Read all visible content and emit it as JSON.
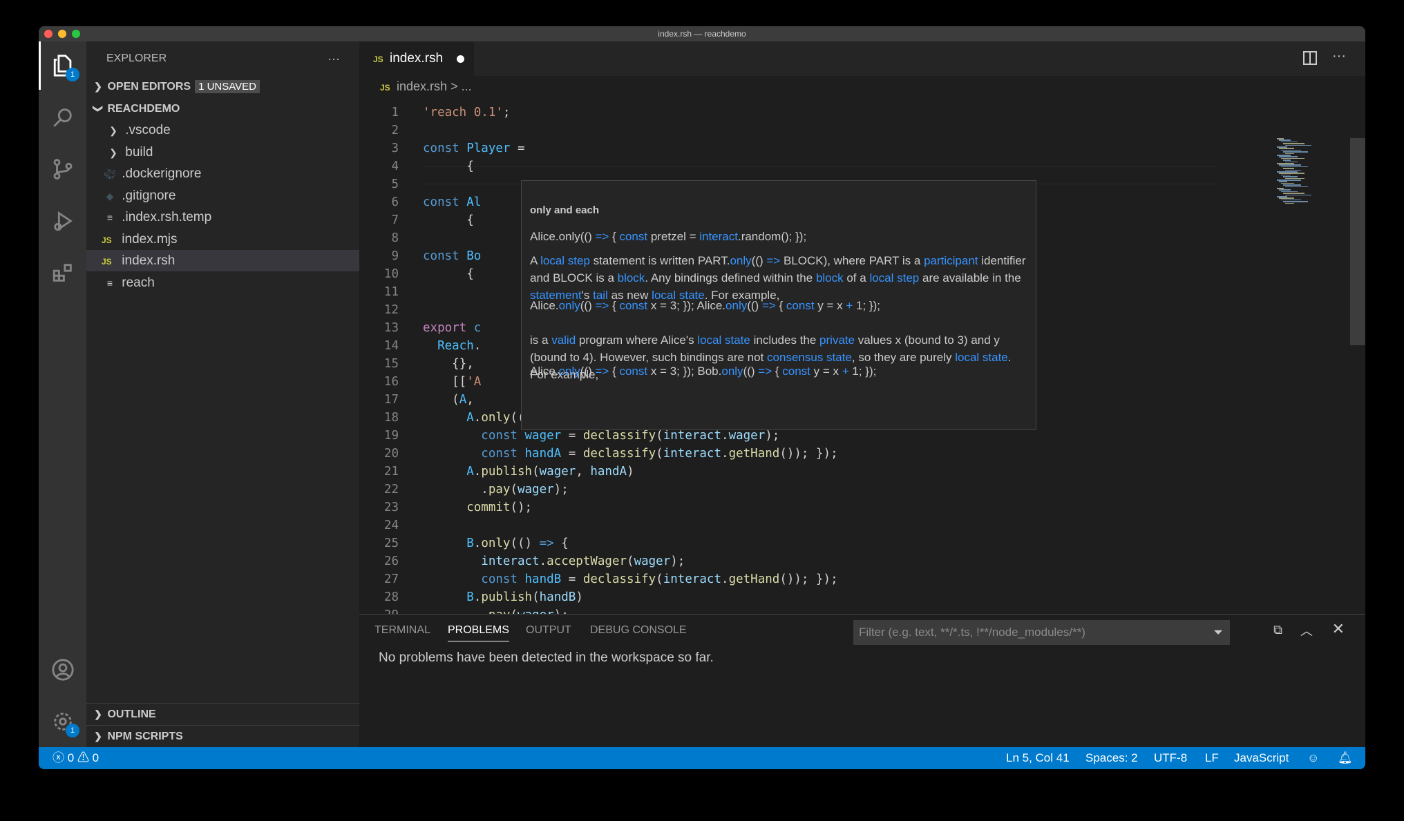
{
  "window": {
    "title": "index.rsh — reachdemo"
  },
  "activity": {
    "explorer_badge": "1",
    "settings_badge": "1"
  },
  "sidebar": {
    "title": "EXPLORER",
    "more": "···",
    "open_editors": "OPEN EDITORS",
    "unsaved_badge": "1 UNSAVED",
    "folder": "REACHDEMO",
    "items": [
      {
        "label": ".vscode",
        "kind": "folder"
      },
      {
        "label": "build",
        "kind": "folder"
      },
      {
        "label": ".dockerignore",
        "kind": "docker"
      },
      {
        "label": ".gitignore",
        "kind": "git"
      },
      {
        "label": ".index.rsh.temp",
        "kind": "text"
      },
      {
        "label": "index.mjs",
        "kind": "js"
      },
      {
        "label": "index.rsh",
        "kind": "js",
        "selected": true
      },
      {
        "label": "reach",
        "kind": "text"
      }
    ],
    "outline": "OUTLINE",
    "npm_scripts": "NPM SCRIPTS"
  },
  "editor": {
    "tab": {
      "icon": "JS",
      "label": "index.rsh",
      "dirty": true
    },
    "breadcrumb": {
      "icon": "JS",
      "file": "index.rsh",
      "sep": ">",
      "rest": "..."
    },
    "lines": [
      [
        [
          "s",
          "'reach 0.1'"
        ],
        [
          "p",
          ";"
        ]
      ],
      [],
      [
        [
          "k",
          "const "
        ],
        [
          "c",
          "Player"
        ],
        [
          "p",
          " ="
        ]
      ],
      [
        [
          "p",
          "      {"
        ]
      ],
      [],
      [
        [
          "k",
          "const "
        ],
        [
          "c",
          "Al"
        ]
      ],
      [
        [
          "p",
          "      {"
        ]
      ],
      [],
      [
        [
          "k",
          "const "
        ],
        [
          "c",
          "Bo"
        ]
      ],
      [
        [
          "p",
          "      {"
        ]
      ],
      [],
      [],
      [
        [
          "x",
          "export "
        ],
        [
          "k",
          "c"
        ]
      ],
      [
        [
          "c",
          "  Reach"
        ],
        [
          "p",
          "."
        ]
      ],
      [
        [
          "p",
          "    {},"
        ]
      ],
      [
        [
          "p",
          "    [["
        ],
        [
          "s",
          "'A"
        ]
      ],
      [
        [
          "p",
          "    ("
        ],
        [
          "c",
          "A"
        ],
        [
          "p",
          ","
        ]
      ],
      [
        [
          "c",
          "      A"
        ],
        [
          "p",
          "."
        ],
        [
          "f",
          "only"
        ],
        [
          "p",
          "(() "
        ],
        [
          "k",
          "=>"
        ],
        [
          "p",
          " {"
        ]
      ],
      [
        [
          "k",
          "        const "
        ],
        [
          "c",
          "wager"
        ],
        [
          "p",
          " = "
        ],
        [
          "f",
          "declassify"
        ],
        [
          "p",
          "("
        ],
        [
          "v",
          "interact"
        ],
        [
          "p",
          "."
        ],
        [
          "v",
          "wager"
        ],
        [
          "p",
          ");"
        ]
      ],
      [
        [
          "k",
          "        const "
        ],
        [
          "c",
          "handA"
        ],
        [
          "p",
          " = "
        ],
        [
          "f",
          "declassify"
        ],
        [
          "p",
          "("
        ],
        [
          "v",
          "interact"
        ],
        [
          "p",
          "."
        ],
        [
          "f",
          "getHand"
        ],
        [
          "p",
          "()); });"
        ]
      ],
      [
        [
          "c",
          "      A"
        ],
        [
          "p",
          "."
        ],
        [
          "f",
          "publish"
        ],
        [
          "p",
          "("
        ],
        [
          "v",
          "wager"
        ],
        [
          "p",
          ", "
        ],
        [
          "v",
          "handA"
        ],
        [
          "p",
          ")"
        ]
      ],
      [
        [
          "p",
          "        ."
        ],
        [
          "f",
          "pay"
        ],
        [
          "p",
          "("
        ],
        [
          "v",
          "wager"
        ],
        [
          "p",
          ");"
        ]
      ],
      [
        [
          "f",
          "      commit"
        ],
        [
          "p",
          "();"
        ]
      ],
      [],
      [
        [
          "c",
          "      B"
        ],
        [
          "p",
          "."
        ],
        [
          "f",
          "only"
        ],
        [
          "p",
          "(() "
        ],
        [
          "k",
          "=>"
        ],
        [
          "p",
          " {"
        ]
      ],
      [
        [
          "v",
          "        interact"
        ],
        [
          "p",
          "."
        ],
        [
          "f",
          "acceptWager"
        ],
        [
          "p",
          "("
        ],
        [
          "v",
          "wager"
        ],
        [
          "p",
          ");"
        ]
      ],
      [
        [
          "k",
          "        const "
        ],
        [
          "c",
          "handB"
        ],
        [
          "p",
          " = "
        ],
        [
          "f",
          "declassify"
        ],
        [
          "p",
          "("
        ],
        [
          "v",
          "interact"
        ],
        [
          "p",
          "."
        ],
        [
          "f",
          "getHand"
        ],
        [
          "p",
          "()); });"
        ]
      ],
      [
        [
          "c",
          "      B"
        ],
        [
          "p",
          "."
        ],
        [
          "f",
          "publish"
        ],
        [
          "p",
          "("
        ],
        [
          "v",
          "handB"
        ],
        [
          "p",
          ")"
        ]
      ],
      [
        [
          "p",
          "        ."
        ],
        [
          "f",
          "pay"
        ],
        [
          "p",
          "("
        ],
        [
          "v",
          "wager"
        ],
        [
          "p",
          ");"
        ]
      ]
    ],
    "tooltip": {
      "title": "only and each",
      "paragraphs": [
        [
          [
            "t",
            "Alice.only(() "
          ],
          [
            "a",
            "=>"
          ],
          [
            "t",
            " { "
          ],
          [
            "a",
            "const"
          ],
          [
            "t",
            " pretzel = "
          ],
          [
            "a",
            "interact"
          ],
          [
            "t",
            ".random(); });"
          ]
        ],
        [
          [
            "t",
            "A "
          ],
          [
            "a",
            "local step"
          ],
          [
            "t",
            " statement is written PART."
          ],
          [
            "a",
            "only"
          ],
          [
            "t",
            "(() "
          ],
          [
            "a",
            "=>"
          ],
          [
            "t",
            " BLOCK), where PART is a "
          ],
          [
            "a",
            "participant"
          ],
          [
            "t",
            " identifier and BLOCK is a "
          ],
          [
            "a",
            "block"
          ],
          [
            "t",
            ". Any bindings defined within the "
          ],
          [
            "a",
            "block"
          ],
          [
            "t",
            " of a "
          ],
          [
            "a",
            "local step"
          ],
          [
            "t",
            " are available in the "
          ],
          [
            "a",
            "statement"
          ],
          [
            "t",
            "'s "
          ],
          [
            "a",
            "tail"
          ],
          [
            "t",
            " as new "
          ],
          [
            "a",
            "local state"
          ],
          [
            "t",
            ". For example,"
          ]
        ],
        [
          [
            "t",
            "Alice."
          ],
          [
            "a",
            "only"
          ],
          [
            "t",
            "(() "
          ],
          [
            "a",
            "=>"
          ],
          [
            "t",
            " { "
          ],
          [
            "a",
            "const"
          ],
          [
            "t",
            " x = 3; }); Alice."
          ],
          [
            "a",
            "only"
          ],
          [
            "t",
            "(() "
          ],
          [
            "a",
            "=>"
          ],
          [
            "t",
            " { "
          ],
          [
            "a",
            "const"
          ],
          [
            "t",
            " y = x "
          ],
          [
            "a",
            "+"
          ],
          [
            "t",
            " 1; });"
          ]
        ],
        [
          [
            "t",
            "is a "
          ],
          [
            "a",
            "valid"
          ],
          [
            "t",
            " program where Alice's "
          ],
          [
            "a",
            "local state"
          ],
          [
            "t",
            " includes the "
          ],
          [
            "a",
            "private"
          ],
          [
            "t",
            " values x (bound to 3) and y (bound to 4). However, such bindings are not "
          ],
          [
            "a",
            "consensus state"
          ],
          [
            "t",
            ", so they are purely "
          ],
          [
            "a",
            "local state"
          ],
          [
            "t",
            ". For example,"
          ]
        ],
        [
          [
            "t",
            "Alice."
          ],
          [
            "a",
            "only"
          ],
          [
            "t",
            "(() "
          ],
          [
            "a",
            "=>"
          ],
          [
            "t",
            " { "
          ],
          [
            "a",
            "const"
          ],
          [
            "t",
            " x = 3; }); Bob."
          ],
          [
            "a",
            "only"
          ],
          [
            "t",
            "(() "
          ],
          [
            "a",
            "=>"
          ],
          [
            "t",
            " { "
          ],
          [
            "a",
            "const"
          ],
          [
            "t",
            " y = x "
          ],
          [
            "a",
            "+"
          ],
          [
            "t",
            " 1; });"
          ]
        ]
      ]
    }
  },
  "panel": {
    "tabs": [
      "TERMINAL",
      "PROBLEMS",
      "OUTPUT",
      "DEBUG CONSOLE"
    ],
    "active_tab": "PROBLEMS",
    "filter_placeholder": "Filter (e.g. text, **/*.ts, !**/node_modules/**)",
    "message": "No problems have been detected in the workspace so far."
  },
  "status": {
    "errors": "0",
    "warnings": "0",
    "position": "Ln 5, Col 41",
    "spaces": "Spaces: 2",
    "encoding": "UTF-8",
    "eol": "LF",
    "language": "JavaScript"
  },
  "colors": {
    "status_bar": "#007acc",
    "link": "#3794ff",
    "keyword": "#569cd6",
    "string": "#ce9178",
    "function": "#dcdcaa"
  }
}
